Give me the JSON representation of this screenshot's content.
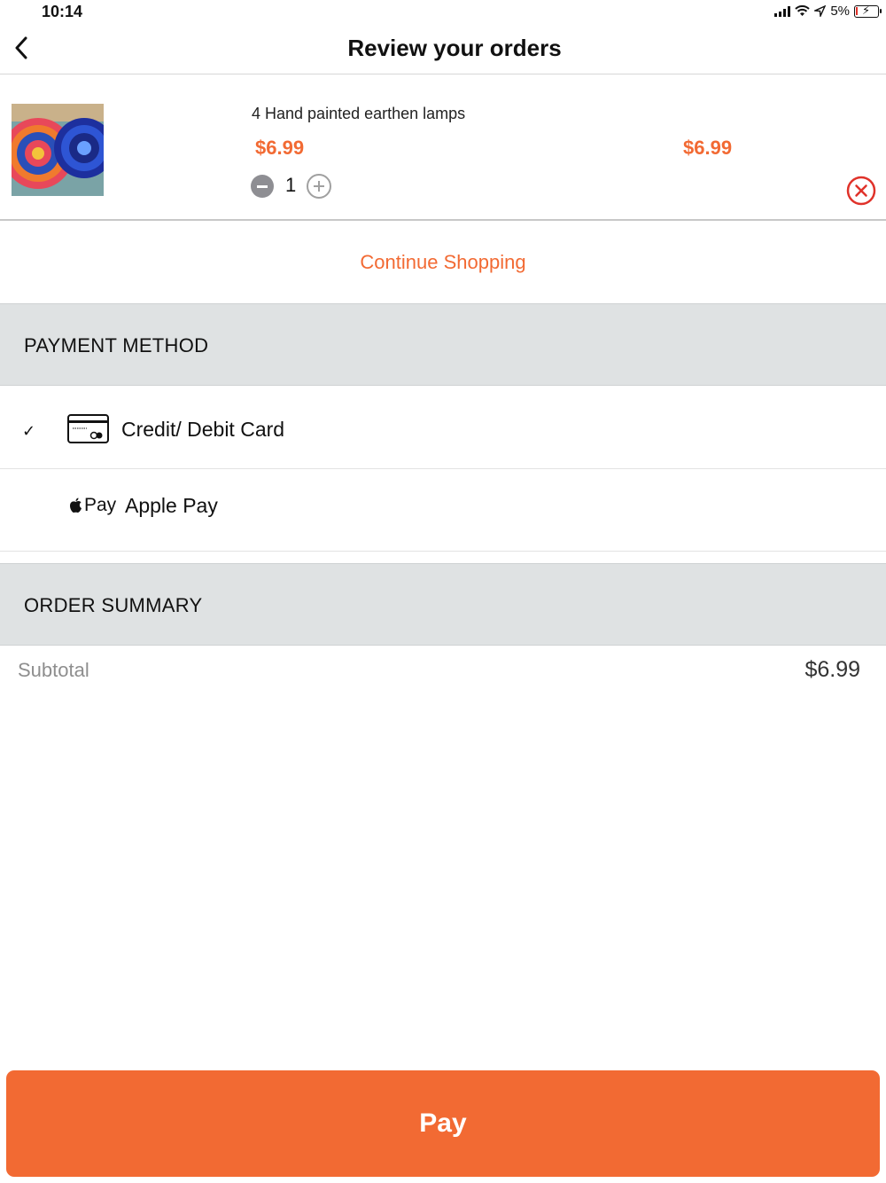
{
  "status_bar": {
    "time": "10:14",
    "battery_percent": "5%",
    "wifi_icon": "wifi-icon",
    "location_icon": "location-arrow-icon"
  },
  "nav": {
    "title": "Review your orders",
    "back_icon": "chevron-left-icon"
  },
  "order": {
    "items": [
      {
        "name": "4 Hand painted earthen lamps",
        "unit_price": "$6.99",
        "total_price": "$6.99",
        "quantity": "1"
      }
    ],
    "remove_icon": "close-circle-icon"
  },
  "continue_shopping": "Continue Shopping",
  "payment": {
    "header": "PAYMENT METHOD",
    "methods": [
      {
        "label": "Credit/ Debit Card",
        "selected": true,
        "icon": "credit-card-icon"
      },
      {
        "label": "Apple Pay",
        "selected": false,
        "icon": "apple-pay-icon",
        "icon_text": "Pay"
      }
    ],
    "check_mark": "✓"
  },
  "summary": {
    "header": "ORDER SUMMARY",
    "subtotal_label": "Subtotal",
    "subtotal_value": "$6.99"
  },
  "pay_button": "Pay",
  "colors": {
    "accent": "#f26a33",
    "section_bg": "#dfe2e3",
    "remove_red": "#e0322a"
  }
}
